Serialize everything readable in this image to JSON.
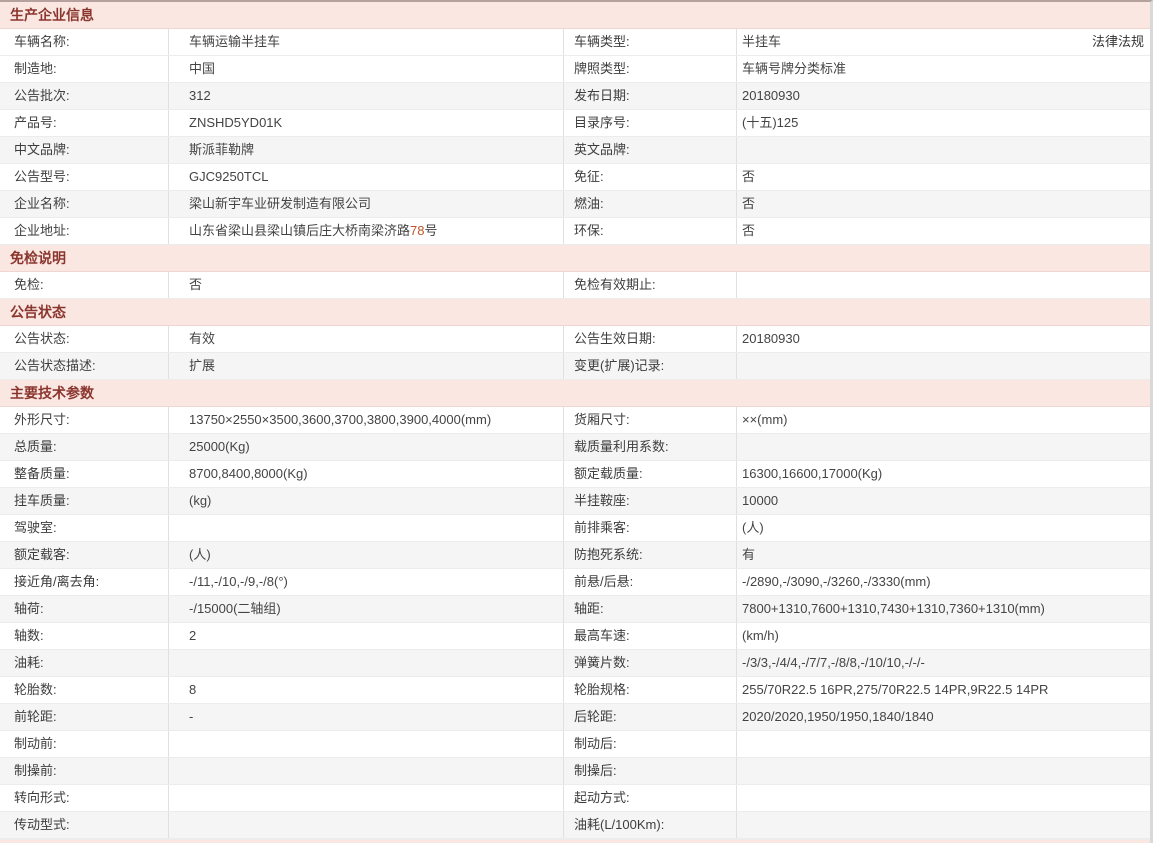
{
  "colors": {
    "header_bg": "#fbe7e2",
    "header_text": "#8a362e",
    "stripe": "#f5f5f5",
    "highlight": "#bf5329",
    "top_line": "#b5a29e"
  },
  "law_link_label": "法律法规",
  "sections": [
    {
      "title": "生产企业信息",
      "rows": [
        {
          "ll": "车辆名称:",
          "lv": "车辆运输半挂车",
          "rl": "车辆类型:",
          "rv": "半挂车",
          "shade": false,
          "link": true
        },
        {
          "ll": "制造地:",
          "lv": "中国",
          "rl": "牌照类型:",
          "rv": "车辆号牌分类标准",
          "shade": false
        },
        {
          "ll": "公告批次:",
          "lv": "312",
          "rl": "发布日期:",
          "rv": "20180930",
          "shade": true
        },
        {
          "ll": "产品号:",
          "lv": "ZNSHD5YD01K",
          "rl": "目录序号:",
          "rv": "(十五)125",
          "shade": false
        },
        {
          "ll": "中文品牌:",
          "lv": "斯派菲勒牌",
          "rl": "英文品牌:",
          "rv": "",
          "shade": true
        },
        {
          "ll": "公告型号:",
          "lv": "GJC9250TCL",
          "rl": "免征:",
          "rv": "否",
          "shade": false
        },
        {
          "ll": "企业名称:",
          "lv": "梁山新宇车业研发制造有限公司",
          "rl": "燃油:",
          "rv": "否",
          "shade": true
        },
        {
          "ll": "企业地址:",
          "lv": "山东省梁山县梁山镇后庄大桥南梁济路78号",
          "hl": "78",
          "rl": "环保:",
          "rv": "否",
          "shade": false
        }
      ]
    },
    {
      "title": "免检说明",
      "rows": [
        {
          "ll": "免检:",
          "lv": "否",
          "rl": "免检有效期止:",
          "rv": "",
          "shade": false
        }
      ]
    },
    {
      "title": "公告状态",
      "rows": [
        {
          "ll": "公告状态:",
          "lv": "有效",
          "rl": "公告生效日期:",
          "rv": "20180930",
          "shade": false
        },
        {
          "ll": "公告状态描述:",
          "lv": "扩展",
          "rl": "变更(扩展)记录:",
          "rv": "",
          "shade": true
        }
      ]
    },
    {
      "title": "主要技术参数",
      "rows": [
        {
          "ll": "外形尺寸:",
          "lv": "13750×2550×3500,3600,3700,3800,3900,4000(mm)",
          "rl": "货厢尺寸:",
          "rv": "××(mm)",
          "shade": false
        },
        {
          "ll": "总质量:",
          "lv": "25000(Kg)",
          "rl": "载质量利用系数:",
          "rv": "",
          "shade": true
        },
        {
          "ll": "整备质量:",
          "lv": "8700,8400,8000(Kg)",
          "rl": "额定载质量:",
          "rv": "16300,16600,17000(Kg)",
          "shade": false
        },
        {
          "ll": "挂车质量:",
          "lv": "(kg)",
          "rl": "半挂鞍座:",
          "rv": "10000",
          "shade": true
        },
        {
          "ll": "驾驶室:",
          "lv": "",
          "rl": "前排乘客:",
          "rv": "(人)",
          "shade": false
        },
        {
          "ll": "额定载客:",
          "lv": "(人)",
          "rl": "防抱死系统:",
          "rv": "有",
          "shade": true
        },
        {
          "ll": "接近角/离去角:",
          "lv": "-/11,-/10,-/9,-/8(°)",
          "rl": "前悬/后悬:",
          "rv": "-/2890,-/3090,-/3260,-/3330(mm)",
          "shade": false
        },
        {
          "ll": "轴荷:",
          "lv": "-/15000(二轴组)",
          "rl": "轴距:",
          "rv": "7800+1310,7600+1310,7430+1310,7360+1310(mm)",
          "shade": true
        },
        {
          "ll": "轴数:",
          "lv": "2",
          "rl": "最高车速:",
          "rv": "(km/h)",
          "shade": false
        },
        {
          "ll": "油耗:",
          "lv": "",
          "rl": "弹簧片数:",
          "rv": "-/3/3,-/4/4,-/7/7,-/8/8,-/10/10,-/-/-",
          "shade": true
        },
        {
          "ll": "轮胎数:",
          "lv": "8",
          "rl": "轮胎规格:",
          "rv": "255/70R22.5 16PR,275/70R22.5 14PR,9R22.5 14PR",
          "shade": false
        },
        {
          "ll": "前轮距:",
          "lv": "-",
          "rl": "后轮距:",
          "rv": "2020/2020,1950/1950,1840/1840",
          "shade": true
        },
        {
          "ll": "制动前:",
          "lv": "",
          "rl": "制动后:",
          "rv": "",
          "shade": false
        },
        {
          "ll": "制操前:",
          "lv": "",
          "rl": "制操后:",
          "rv": "",
          "shade": true
        },
        {
          "ll": "转向形式:",
          "lv": "",
          "rl": "起动方式:",
          "rv": "",
          "shade": false
        },
        {
          "ll": "传动型式:",
          "lv": "",
          "rl": "油耗(L/100Km):",
          "rv": "",
          "shade": true
        }
      ]
    }
  ]
}
